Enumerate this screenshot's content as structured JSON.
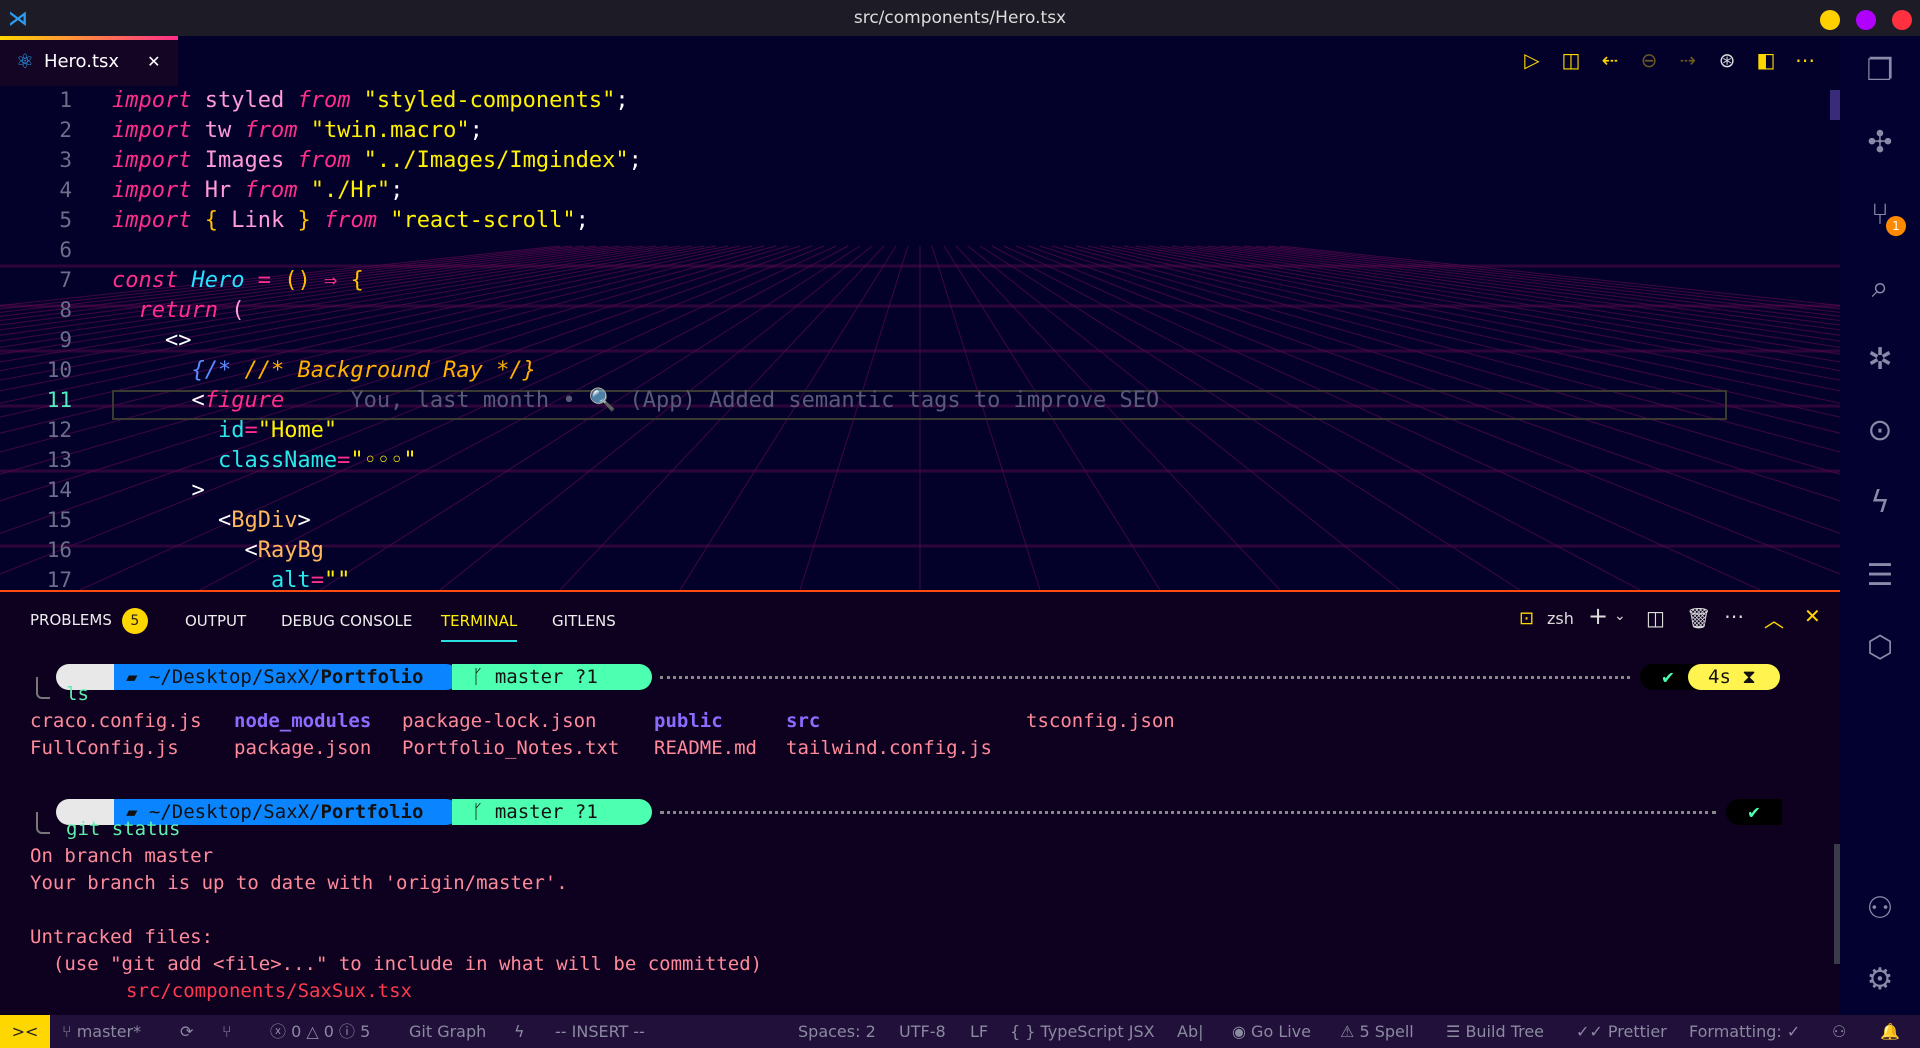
{
  "window": {
    "title": "src/components/Hero.tsx",
    "controls": [
      "#ffd000",
      "#b000ff",
      "#ff3040"
    ]
  },
  "tab": {
    "label": "Hero.tsx",
    "icon": "react-icon",
    "close": "✕"
  },
  "toolbar": [
    "run-icon",
    "open-changes-icon",
    "previous-change-icon",
    "timeline-icon",
    "next-change-icon",
    "git-graph-icon",
    "split-editor-icon",
    "more-icon"
  ],
  "editor": {
    "line_numbers": [
      "1",
      "2",
      "3",
      "4",
      "5",
      "6",
      "7",
      "8",
      "9",
      "10",
      "11",
      "12",
      "13",
      "14",
      "15",
      "16",
      "17"
    ],
    "current_line": "11",
    "lines": [
      [
        [
          "import",
          "kw"
        ],
        [
          " styled ",
          "id"
        ],
        [
          "from",
          "kw"
        ],
        [
          " \"styled-components\"",
          "str"
        ],
        [
          ";",
          "pun"
        ]
      ],
      [
        [
          "import",
          "kw"
        ],
        [
          " tw ",
          "id"
        ],
        [
          "from",
          "kw"
        ],
        [
          " \"twin.macro\"",
          "str"
        ],
        [
          ";",
          "pun"
        ]
      ],
      [
        [
          "import",
          "kw"
        ],
        [
          " Images ",
          "id"
        ],
        [
          "from",
          "kw"
        ],
        [
          " \"../Images/Imgindex\"",
          "str"
        ],
        [
          ";",
          "pun"
        ]
      ],
      [
        [
          "import",
          "kw"
        ],
        [
          " Hr ",
          "id"
        ],
        [
          "from",
          "kw"
        ],
        [
          " \"./Hr\"",
          "str"
        ],
        [
          ";",
          "pun"
        ]
      ],
      [
        [
          "import",
          "kw"
        ],
        [
          " { ",
          "br"
        ],
        [
          "Link",
          "id"
        ],
        [
          " } ",
          "br"
        ],
        [
          "from",
          "kw"
        ],
        [
          " \"react-scroll\"",
          "str"
        ],
        [
          ";",
          "pun"
        ]
      ],
      [],
      [
        [
          "const ",
          "kw"
        ],
        [
          "Hero",
          "fn"
        ],
        [
          " = ",
          "op"
        ],
        [
          "() ",
          "br"
        ],
        [
          "⇒ ",
          "op"
        ],
        [
          "{",
          "br"
        ]
      ],
      [
        [
          "  return ",
          "kw"
        ],
        [
          "(",
          "id"
        ]
      ],
      [
        [
          "    <>",
          "pun"
        ]
      ],
      [
        [
          "      {/*",
          "cmb"
        ],
        [
          " //* Background Ray */}",
          "cm"
        ]
      ],
      [
        [
          "      <",
          "pun"
        ],
        [
          "figure",
          "tagp"
        ],
        [
          "     You, last month • 🔍 (App) Added semantic tags to improve SEO",
          "blame"
        ]
      ],
      [
        [
          "        id",
          "attr"
        ],
        [
          "=",
          "op"
        ],
        [
          "\"Home\"",
          "str"
        ]
      ],
      [
        [
          "        className",
          "attr"
        ],
        [
          "=",
          "op"
        ],
        [
          "\"◦◦◦\"",
          "str"
        ]
      ],
      [
        [
          "      >",
          "pun"
        ]
      ],
      [
        [
          "        <",
          "pun"
        ],
        [
          "BgDiv",
          "tag"
        ],
        [
          ">",
          "pun"
        ]
      ],
      [
        [
          "          <",
          "pun"
        ],
        [
          "RayBg",
          "tag"
        ]
      ],
      [
        [
          "            alt",
          "attr"
        ],
        [
          "=",
          "op"
        ],
        [
          "\"\"",
          "str"
        ]
      ]
    ]
  },
  "panel": {
    "tabs": [
      "PROBLEMS",
      "OUTPUT",
      "DEBUG CONSOLE",
      "TERMINAL",
      "GITLENS"
    ],
    "problems_count": "5",
    "active": "TERMINAL",
    "shell": "zsh"
  },
  "terminal": {
    "prompt": {
      "path_prefix": "~/Desktop/SaxX/",
      "path_bold": "Portfolio",
      "branch": "master ?1",
      "duration": "4s",
      "ok": "✔"
    },
    "cmd1": "ls",
    "files_row1": [
      [
        "craco.config.js",
        "pink"
      ],
      [
        "node_modules",
        "purp"
      ],
      [
        "package-lock.json",
        "pink"
      ],
      [
        "public",
        "purp"
      ],
      [
        "src",
        "purp"
      ],
      [
        "tsconfig.json",
        "pink"
      ]
    ],
    "files_row2": [
      [
        "FullConfig.js",
        "pink"
      ],
      [
        "package.json",
        "pink"
      ],
      [
        "Portfolio_Notes.txt",
        "pink"
      ],
      [
        "README.md",
        "pink"
      ],
      [
        "tailwind.config.js",
        "pink"
      ]
    ],
    "cmd2": "git status",
    "out": [
      "On branch master",
      "Your branch is up to date with 'origin/master'.",
      "",
      "Untracked files:",
      "  (use \"git add <file>...\" to include in what will be committed)"
    ],
    "untracked": "src/components/SaxSux.tsx"
  },
  "statusbar": {
    "remote": "><",
    "branch": "master*",
    "errors": "0",
    "warnings": "0",
    "infos": "5",
    "git_graph": "Git Graph",
    "mode": "-- INSERT --",
    "spaces": "Spaces: 2",
    "encoding": "UTF-8",
    "eol": "LF",
    "language": "TypeScript JSX",
    "spell_mode": "Ab|",
    "go_live": "Go Live",
    "spell": "5 Spell",
    "build_tree": "Build Tree",
    "prettier": "Prettier",
    "formatting": "Formatting: ✓"
  },
  "activity": {
    "source_control_badge": "1"
  }
}
